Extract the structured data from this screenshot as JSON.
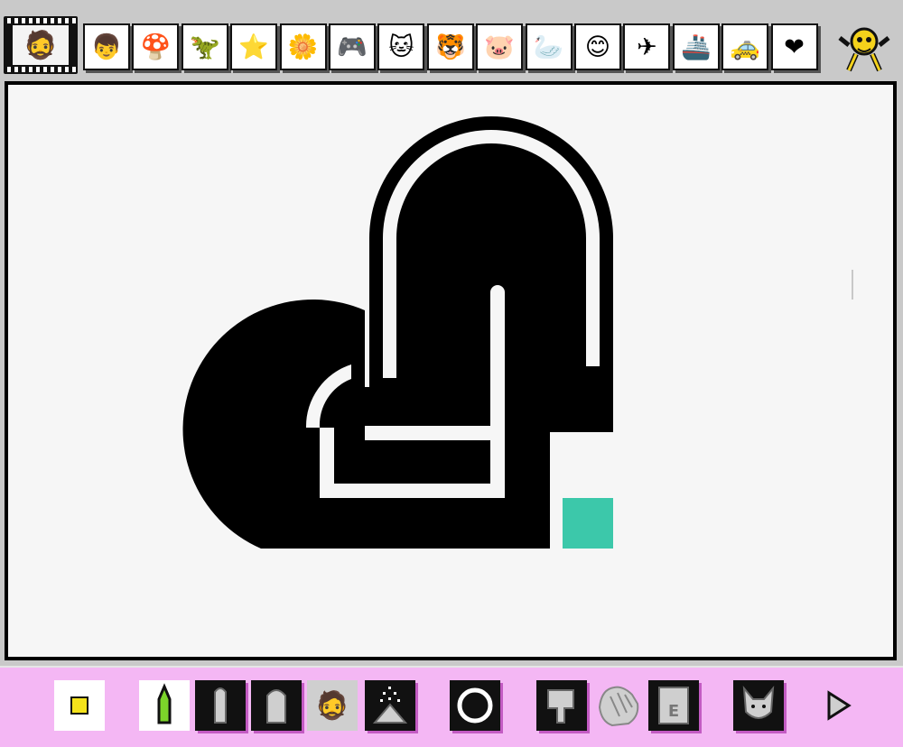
{
  "app": {
    "stamp_strip_icon": "mario-face-icon",
    "stamps": [
      {
        "name": "mario-stamp-icon",
        "glyph": "👦"
      },
      {
        "name": "mushroom-stamp-icon",
        "glyph": "🍄"
      },
      {
        "name": "yoshi-stamp-icon",
        "glyph": "🦖"
      },
      {
        "name": "star-stamp-icon",
        "glyph": "⭐"
      },
      {
        "name": "fire-flower-stamp-icon",
        "glyph": "🌼"
      },
      {
        "name": "gameboy-stamp-icon",
        "glyph": "🎮"
      },
      {
        "name": "cat-stamp-icon",
        "glyph": "🐱"
      },
      {
        "name": "tiger-stamp-icon",
        "glyph": "🐯"
      },
      {
        "name": "pig-stamp-icon",
        "glyph": "🐷"
      },
      {
        "name": "bird-stamp-icon",
        "glyph": "🦢"
      },
      {
        "name": "baby-face-stamp-icon",
        "glyph": "😊"
      },
      {
        "name": "airplane-stamp-icon",
        "glyph": "✈"
      },
      {
        "name": "ship-stamp-icon",
        "glyph": "🚢"
      },
      {
        "name": "car-stamp-icon",
        "glyph": "🚕"
      },
      {
        "name": "heart-stamp-icon",
        "glyph": "❤"
      }
    ],
    "mascot_icon": "yellow-creature-icon"
  },
  "canvas": {
    "logo_name": "interlocked-heart-logo",
    "accent_square_color": "#3cc8aa",
    "logo_color": "#000000"
  },
  "toolbar": {
    "tools": [
      "brush-size-icon",
      "pencil-icon",
      "marker-icon",
      "thick-marker-icon",
      "stamp-tool-icon",
      "spray-icon",
      "shape-circle-icon",
      "paint-bucket-icon",
      "undo-dog-hand-icon",
      "eraser-icon",
      "wolf-menu-icon",
      "next-arrow-icon"
    ],
    "eraser_label": "E"
  }
}
